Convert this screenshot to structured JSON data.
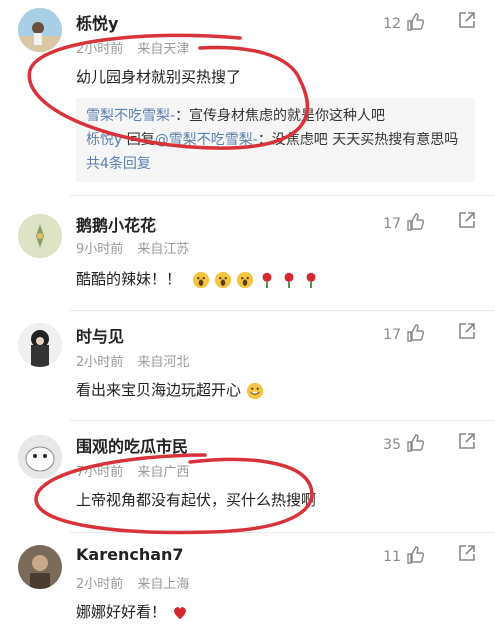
{
  "comments": [
    {
      "username": "栎悦y",
      "time": "2小时前",
      "location": "来自天津",
      "text": "幼儿园身材就别买热搜了",
      "likes": "12",
      "replies": [
        {
          "nick": "雪梨不吃雪梨-",
          "text": "：宣传身材焦虑的就是你这种人吧"
        },
        {
          "nick": "栎悦y",
          "reply_word": "回复",
          "target": "@雪梨不吃雪梨-",
          "text": "：没焦虑吧 天天买热搜有意思吗"
        }
      ],
      "reply_count": "共4条回复"
    },
    {
      "username": "鹅鹅小花花",
      "time": "9小时前",
      "location": "来自江苏",
      "text": "酷酷的辣妹！！",
      "likes": "17"
    },
    {
      "username": "时与见",
      "time": "2小时前",
      "location": "来自河北",
      "text": "看出来宝贝海边玩超开心",
      "likes": "17"
    },
    {
      "username": "围观的吃瓜市民",
      "time": "7小时前",
      "location": "来自广西",
      "text": "上帝视角都没有起伏，买什么热搜啊",
      "likes": "35"
    },
    {
      "username": "Karenchan7",
      "time": "2小时前",
      "location": "来自上海",
      "text": "娜娜好好看！",
      "likes": "11"
    }
  ],
  "colors": {
    "accent_link": "#5b7fb0",
    "annotation_red": "#d8333a",
    "meta_gray": "#9a9a9a"
  },
  "icons": {
    "like": "thumbs-up-icon",
    "share": "share-icon",
    "emoji_scream": "face-screaming-emoji",
    "emoji_rose": "rose-emoji",
    "emoji_grin": "grinning-sweat-emoji",
    "emoji_heart": "red-heart-emoji"
  }
}
